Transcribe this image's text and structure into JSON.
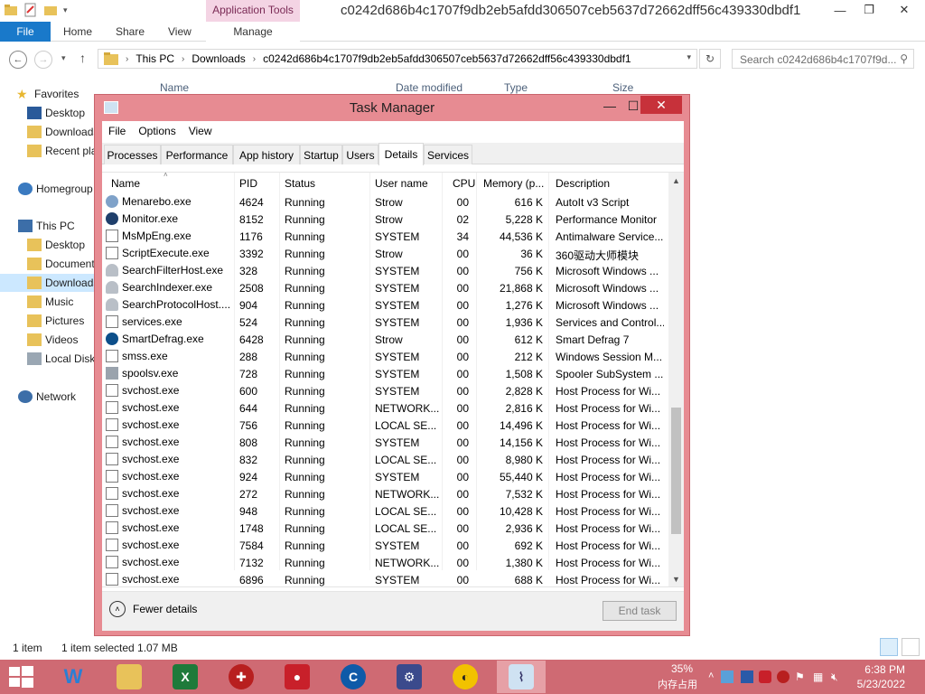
{
  "explorer": {
    "window_title": "c0242d686b4c1707f9db2eb5afdd306507ceb5637d72662dff56c439330dbdf1",
    "context_tab": "Application Tools",
    "ribbon_tabs": [
      "File",
      "Home",
      "Share",
      "View",
      "Manage"
    ],
    "address": {
      "crumbs": [
        "This PC",
        "Downloads",
        "c0242d686b4c1707f9db2eb5afdd306507ceb5637d72662dff56c439330dbdf1"
      ]
    },
    "search_placeholder": "Search c0242d686b4c1707f9d...",
    "columns": [
      "Name",
      "Date modified",
      "Type",
      "Size"
    ],
    "nav": {
      "favorites": "Favorites",
      "desktop": "Desktop",
      "downloads": "Downloads",
      "recent": "Recent places",
      "homegroup": "Homegroup",
      "thispc": "This PC",
      "pc_desktop": "Desktop",
      "documents": "Documents",
      "pc_downloads": "Downloads",
      "music": "Music",
      "pictures": "Pictures",
      "videos": "Videos",
      "localdisk": "Local Disk",
      "network": "Network"
    },
    "status": {
      "items": "1 item",
      "selected": "1 item selected  1.07 MB"
    }
  },
  "taskmanager": {
    "title": "Task Manager",
    "menu": [
      "File",
      "Options",
      "View"
    ],
    "tabs": [
      "Processes",
      "Performance",
      "App history",
      "Startup",
      "Users",
      "Details",
      "Services"
    ],
    "active_tab": "Details",
    "columns": {
      "name": "Name",
      "pid": "PID",
      "status": "Status",
      "user": "User name",
      "cpu": "CPU",
      "memory": "Memory (p...",
      "description": "Description"
    },
    "rows": [
      {
        "name": "Menarebo.exe",
        "pid": "4624",
        "status": "Running",
        "user": "Strow",
        "cpu": "00",
        "mem": "616 K",
        "desc": "AutoIt v3 Script",
        "icon": "autoit-icon"
      },
      {
        "name": "Monitor.exe",
        "pid": "8152",
        "status": "Running",
        "user": "Strow",
        "cpu": "02",
        "mem": "5,228 K",
        "desc": "Performance Monitor",
        "icon": "monitor-icon"
      },
      {
        "name": "MsMpEng.exe",
        "pid": "1176",
        "status": "Running",
        "user": "SYSTEM",
        "cpu": "34",
        "mem": "44,536 K",
        "desc": "Antimalware Service...",
        "icon": "window-icon"
      },
      {
        "name": "ScriptExecute.exe",
        "pid": "3392",
        "status": "Running",
        "user": "Strow",
        "cpu": "00",
        "mem": "36 K",
        "desc": "360驱动大师模块",
        "icon": "window-icon"
      },
      {
        "name": "SearchFilterHost.exe",
        "pid": "328",
        "status": "Running",
        "user": "SYSTEM",
        "cpu": "00",
        "mem": "756 K",
        "desc": "Microsoft Windows ...",
        "icon": "search-user-icon"
      },
      {
        "name": "SearchIndexer.exe",
        "pid": "2508",
        "status": "Running",
        "user": "SYSTEM",
        "cpu": "00",
        "mem": "21,868 K",
        "desc": "Microsoft Windows ...",
        "icon": "search-user-icon"
      },
      {
        "name": "SearchProtocolHost....",
        "pid": "904",
        "status": "Running",
        "user": "SYSTEM",
        "cpu": "00",
        "mem": "1,276 K",
        "desc": "Microsoft Windows ...",
        "icon": "search-user-icon"
      },
      {
        "name": "services.exe",
        "pid": "524",
        "status": "Running",
        "user": "SYSTEM",
        "cpu": "00",
        "mem": "1,936 K",
        "desc": "Services and Control...",
        "icon": "window-icon"
      },
      {
        "name": "SmartDefrag.exe",
        "pid": "6428",
        "status": "Running",
        "user": "Strow",
        "cpu": "00",
        "mem": "612 K",
        "desc": "Smart Defrag 7",
        "icon": "defrag-icon"
      },
      {
        "name": "smss.exe",
        "pid": "288",
        "status": "Running",
        "user": "SYSTEM",
        "cpu": "00",
        "mem": "212 K",
        "desc": "Windows Session M...",
        "icon": "window-icon"
      },
      {
        "name": "spoolsv.exe",
        "pid": "728",
        "status": "Running",
        "user": "SYSTEM",
        "cpu": "00",
        "mem": "1,508 K",
        "desc": "Spooler SubSystem ...",
        "icon": "printer-icon"
      },
      {
        "name": "svchost.exe",
        "pid": "600",
        "status": "Running",
        "user": "SYSTEM",
        "cpu": "00",
        "mem": "2,828 K",
        "desc": "Host Process for Wi...",
        "icon": "window-icon"
      },
      {
        "name": "svchost.exe",
        "pid": "644",
        "status": "Running",
        "user": "NETWORK...",
        "cpu": "00",
        "mem": "2,816 K",
        "desc": "Host Process for Wi...",
        "icon": "window-icon"
      },
      {
        "name": "svchost.exe",
        "pid": "756",
        "status": "Running",
        "user": "LOCAL SE...",
        "cpu": "00",
        "mem": "14,496 K",
        "desc": "Host Process for Wi...",
        "icon": "window-icon"
      },
      {
        "name": "svchost.exe",
        "pid": "808",
        "status": "Running",
        "user": "SYSTEM",
        "cpu": "00",
        "mem": "14,156 K",
        "desc": "Host Process for Wi...",
        "icon": "window-icon"
      },
      {
        "name": "svchost.exe",
        "pid": "832",
        "status": "Running",
        "user": "LOCAL SE...",
        "cpu": "00",
        "mem": "8,980 K",
        "desc": "Host Process for Wi...",
        "icon": "window-icon"
      },
      {
        "name": "svchost.exe",
        "pid": "924",
        "status": "Running",
        "user": "SYSTEM",
        "cpu": "00",
        "mem": "55,440 K",
        "desc": "Host Process for Wi...",
        "icon": "window-icon"
      },
      {
        "name": "svchost.exe",
        "pid": "272",
        "status": "Running",
        "user": "NETWORK...",
        "cpu": "00",
        "mem": "7,532 K",
        "desc": "Host Process for Wi...",
        "icon": "window-icon"
      },
      {
        "name": "svchost.exe",
        "pid": "948",
        "status": "Running",
        "user": "LOCAL SE...",
        "cpu": "00",
        "mem": "10,428 K",
        "desc": "Host Process for Wi...",
        "icon": "window-icon"
      },
      {
        "name": "svchost.exe",
        "pid": "1748",
        "status": "Running",
        "user": "LOCAL SE...",
        "cpu": "00",
        "mem": "2,936 K",
        "desc": "Host Process for Wi...",
        "icon": "window-icon"
      },
      {
        "name": "svchost.exe",
        "pid": "7584",
        "status": "Running",
        "user": "SYSTEM",
        "cpu": "00",
        "mem": "692 K",
        "desc": "Host Process for Wi...",
        "icon": "window-icon"
      },
      {
        "name": "svchost.exe",
        "pid": "7132",
        "status": "Running",
        "user": "NETWORK...",
        "cpu": "00",
        "mem": "1,380 K",
        "desc": "Host Process for Wi...",
        "icon": "window-icon"
      },
      {
        "name": "svchost.exe",
        "pid": "6896",
        "status": "Running",
        "user": "SYSTEM",
        "cpu": "00",
        "mem": "688 K",
        "desc": "Host Process for Wi...",
        "icon": "window-icon"
      }
    ],
    "fewer_details": "Fewer details",
    "end_task": "End task"
  },
  "taskbar": {
    "memory_percent": "35%",
    "memory_label": "内存占用",
    "time": "6:38 PM",
    "date": "5/23/2022"
  },
  "colors": {
    "accent": "#cf6a73",
    "window_frame": "#e78b92",
    "close_red": "#c7313a",
    "file_tab": "#1979ca"
  }
}
